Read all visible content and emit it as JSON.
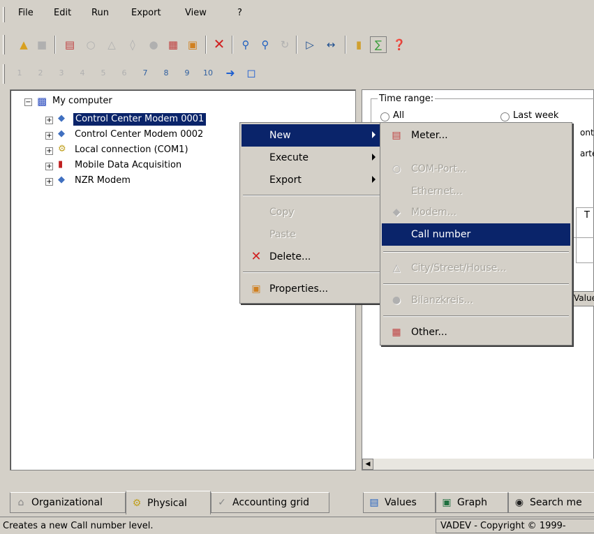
{
  "menubar": {
    "items": [
      "File",
      "Edit",
      "Run",
      "Export",
      "View",
      "?"
    ]
  },
  "toolbar2": {
    "buttons": [
      "1",
      "2",
      "3",
      "4",
      "5",
      "6",
      "7",
      "8",
      "9",
      "10"
    ]
  },
  "tree": {
    "root": "My computer",
    "children": [
      "Control Center Modem 0001",
      "Control Center Modem 0002",
      "Local connection (COM1)",
      "Mobile Data Acquisition",
      "NZR Modem"
    ]
  },
  "context_menu": {
    "items": {
      "new": "New",
      "execute": "Execute",
      "export": "Export",
      "copy": "Copy",
      "paste": "Paste",
      "delete": "Delete...",
      "properties": "Properties..."
    }
  },
  "submenu": {
    "items": {
      "meter": "Meter...",
      "com_port": "COM-Port...",
      "ethernet": "Ethernet...",
      "modem": "Modem...",
      "call_number": "Call number",
      "city": "City/Street/House...",
      "bilanzkreis": "Bilanzkreis...",
      "other": "Other..."
    }
  },
  "right_panel": {
    "time_range_label": "Time range:",
    "opt_all": "All",
    "opt_last_week": "Last week",
    "opt_month_partial": "onth",
    "opt_quarter_partial": "arte",
    "group_t_partial": "T",
    "value_partial": "Value"
  },
  "left_tabs": {
    "organizational": "Organizational",
    "physical": "Physical",
    "accounting": "Accounting grid"
  },
  "right_tabs": {
    "values": "Values",
    "graph": "Graph",
    "search": "Search me"
  },
  "status": {
    "message": "Creates a new Call number level.",
    "copyright": "VADEV - Copyright © 1999-"
  },
  "colors": {
    "selection": "#0a246a",
    "chrome": "#d4d0c8"
  }
}
